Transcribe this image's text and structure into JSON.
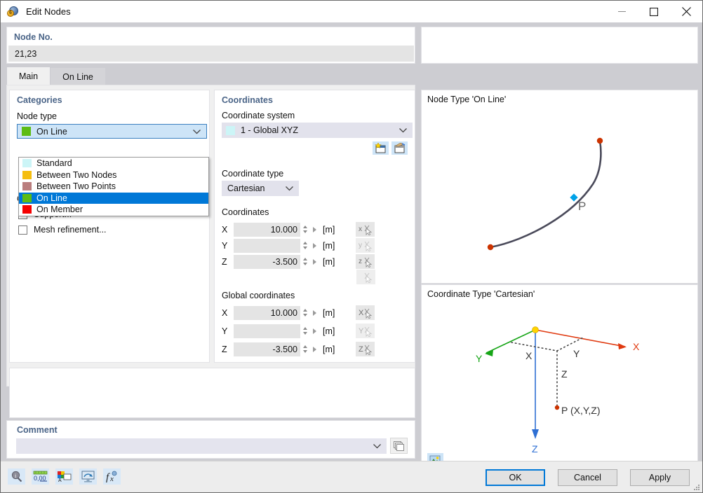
{
  "window": {
    "title": "Edit Nodes",
    "icon": "node-edit-icon",
    "minimize_label": "minimize-icon",
    "maximize_label": "maximize-icon",
    "close_label": "close-icon"
  },
  "node_no": {
    "label": "Node No.",
    "value": "21,23"
  },
  "tabs": [
    {
      "label": "Main",
      "active": true
    },
    {
      "label": "On Line",
      "active": false
    }
  ],
  "categories": {
    "title": "Categories",
    "node_type_label": "Node type",
    "node_type_selected": {
      "label": "On Line",
      "color": "#5DBC14"
    },
    "node_type_options": [
      {
        "label": "Standard",
        "color": "#CCF5F7",
        "selected": false
      },
      {
        "label": "Between Two Nodes",
        "color": "#F5BE10",
        "selected": false
      },
      {
        "label": "Between Two Points",
        "color": "#BA7D7D",
        "selected": false
      },
      {
        "label": "On Line",
        "color": "#5DBC14",
        "selected": true
      },
      {
        "label": "On Member",
        "color": "#F50000",
        "selected": false
      }
    ],
    "options_label": "Options",
    "options": [
      {
        "label": "Support...",
        "checked": false
      },
      {
        "label": "Mesh refinement...",
        "checked": false
      }
    ]
  },
  "coordinates": {
    "title": "Coordinates",
    "coordinate_system_label": "Coordinate system",
    "coordinate_system_value": "1 - Global XYZ",
    "coordinate_system_color": "#CCF5F7",
    "new_cs_button": "new-coordinate-system-icon",
    "edit_cs_button": "edit-coordinate-system-icon",
    "coordinate_type_label": "Coordinate type",
    "coordinate_type_value": "Cartesian",
    "local_section_label": "Coordinates",
    "local_rows": [
      {
        "axis": "X",
        "value": "10.000",
        "unit": "[m]",
        "pick": "pick-x-icon"
      },
      {
        "axis": "Y",
        "value": "",
        "unit": "[m]",
        "pick": "pick-y-icon"
      },
      {
        "axis": "Z",
        "value": "-3.500",
        "unit": "[m]",
        "pick": "pick-z-icon"
      }
    ],
    "extra_pick": "pick-point-icon",
    "global_section_label": "Global coordinates",
    "global_rows": [
      {
        "axis": "X",
        "value": "10.000",
        "unit": "[m]",
        "pick": "pick-global-x-icon"
      },
      {
        "axis": "Y",
        "value": "",
        "unit": "[m]",
        "pick": "pick-global-y-icon"
      },
      {
        "axis": "Z",
        "value": "-3.500",
        "unit": "[m]",
        "pick": "pick-global-z-icon"
      }
    ]
  },
  "preview_top": {
    "title": "Node Type 'On Line'",
    "point_label": "P",
    "line_color": "#4a4a5a",
    "end_node_color": "#CC3300",
    "point_color": "#00A2E8"
  },
  "preview_bottom": {
    "title": "Coordinate Type 'Cartesian'",
    "axis_x_label": "X",
    "axis_y_label": "Y",
    "axis_z_label": "Z",
    "proj_x_label": "X",
    "proj_y_label": "Y",
    "proj_z_label": "Z",
    "point_label": "P (X,Y,Z)",
    "x_color": "#E03A10",
    "y_color": "#16A516",
    "z_color": "#2E6FD4",
    "origin_color": "#FFD400",
    "image_button": "preview-image-icon"
  },
  "comment": {
    "label": "Comment",
    "value": "",
    "dropdown_icon": "chevron-down-icon",
    "library_button": "comment-library-icon"
  },
  "footer": {
    "tools": [
      {
        "name": "info-search-icon"
      },
      {
        "name": "decimal-places-icon",
        "caption": "0,00"
      },
      {
        "name": "display-text-icon"
      },
      {
        "name": "display-properties-icon"
      },
      {
        "name": "function-fx-icon",
        "caption": "f"
      }
    ],
    "buttons": [
      {
        "label": "OK",
        "primary": true
      },
      {
        "label": "Cancel",
        "primary": false
      },
      {
        "label": "Apply",
        "primary": false
      }
    ]
  }
}
